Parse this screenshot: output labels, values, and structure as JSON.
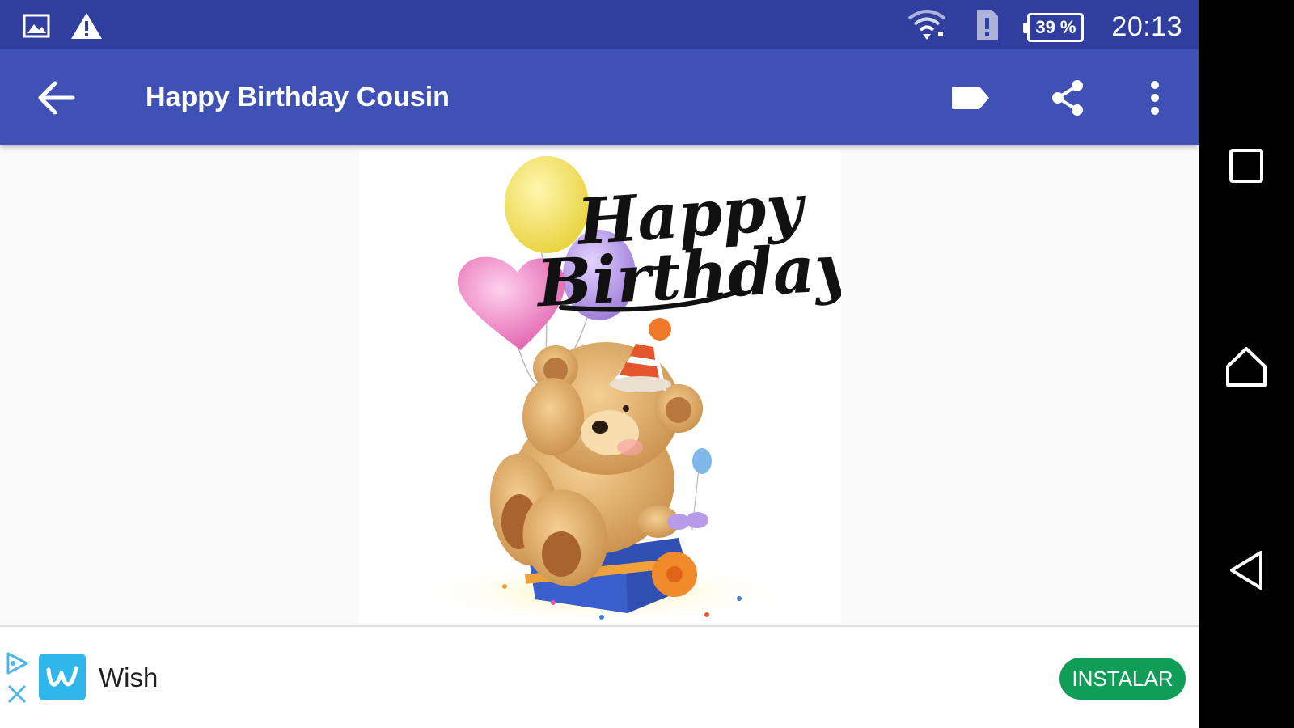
{
  "status_bar": {
    "time": "20:13",
    "battery_percent": "39 %",
    "icons": [
      "image-icon",
      "warning-icon",
      "wifi-icon",
      "sim-alert-icon"
    ]
  },
  "app_bar": {
    "title": "Happy Birthday Cousin",
    "background": "#3f51b5",
    "icons": [
      "back-arrow-icon",
      "label-tag-icon",
      "share-icon",
      "overflow-menu-icon"
    ]
  },
  "card": {
    "line1": "Happy",
    "line2": "Birthday"
  },
  "ad": {
    "app_name": "Wish",
    "install_label": "INSTALAR",
    "install_color": "#0f9d58",
    "logo_color": "#2fb7ec"
  },
  "nav_bar": {
    "icons": [
      "recents-icon",
      "home-icon",
      "back-triangle-icon"
    ]
  }
}
